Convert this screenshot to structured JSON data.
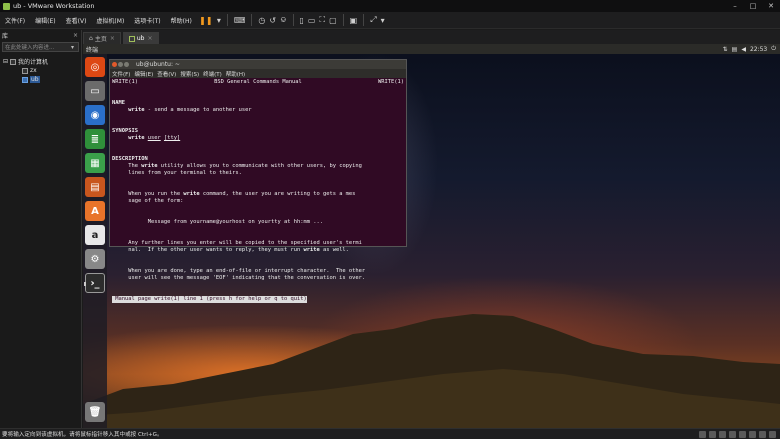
{
  "window": {
    "title": "ub - VMware Workstation"
  },
  "menu": [
    "文件(F)",
    "编辑(E)",
    "查看(V)",
    "虚拟机(M)",
    "选项卡(T)",
    "帮助(H)"
  ],
  "library": {
    "header": "库",
    "close": "×",
    "search_placeholder": "在此处键入内容进...",
    "tree": [
      {
        "label": "我的计算机"
      },
      {
        "label": "zx"
      },
      {
        "label": "ub"
      }
    ]
  },
  "tabs": [
    {
      "label": "主页"
    },
    {
      "label": "ub"
    }
  ],
  "guest": {
    "topbar_title": "终端",
    "clock": "22:53",
    "terminal": {
      "title": "ub@ubuntu: ~",
      "menu": [
        "文件(F)",
        "编辑(E)",
        "查看(V)",
        "搜索(S)",
        "终端(T)",
        "帮助(H)"
      ],
      "header_left": "WRITE(1)",
      "header_center": "BSD General Commands Manual",
      "header_right": "WRITE(1)",
      "name_heading": "NAME",
      "name_cmd": "write",
      "name_desc": " - send a message to another user",
      "synopsis_heading": "SYNOPSIS",
      "synopsis_cmd": "write",
      "synopsis_arg1": "user",
      "synopsis_arg2": "[tty]",
      "description_heading": "DESCRIPTION",
      "desc1_a": "     The ",
      "desc1_b": "write",
      "desc1_c": " utility allows you to communicate with other users, by copying",
      "desc1_d": "     lines from your terminal to theirs.",
      "desc2_a": "     When you run the ",
      "desc2_b": "write",
      "desc2_c": " command, the user you are writing to gets a mes",
      "desc2_d": "     sage of the form:",
      "desc3": "           Message from yourname@yourhost on yourtty at hh:mm ...",
      "desc4_a": "     Any further lines you enter will be copied to the specified user's termi",
      "desc4_b": "     nal.  If the other user wants to reply, they must run ",
      "desc4_c": "write",
      "desc4_d": " as well.",
      "desc5_a": "     When you are done, type an end-of-file or interrupt character.  The other",
      "desc5_b": "     user will see the message 'EOF' indicating that the conversation is over.",
      "statusline": " Manual page write(1) line 1 (press h for help or q to quit)"
    }
  },
  "statusbar": {
    "message": "要将输入定向到该虚拟机，请将鼠标指针移入其中或按 Ctrl+G。"
  },
  "colors": {
    "pause": "#f39a1e",
    "terminal_bg": "#300a24",
    "selection": "#2d5a96"
  }
}
